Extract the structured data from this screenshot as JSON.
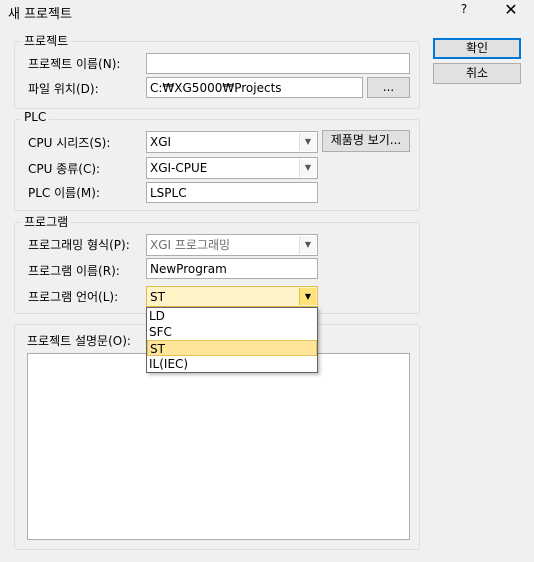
{
  "window": {
    "title": "새 프로젝트",
    "help_label": "?",
    "close_label": "✕"
  },
  "buttons": {
    "ok": "확인",
    "cancel": "취소",
    "browse": "...",
    "view_product": "제품명 보기..."
  },
  "project": {
    "legend": "프로젝트",
    "name_label": "프로젝트 이름(N):",
    "name_value": "",
    "path_label": "파일 위치(D):",
    "path_value": "C:₩XG5000₩Projects"
  },
  "plc": {
    "legend": "PLC",
    "series_label": "CPU 시리즈(S):",
    "series_value": "XGI",
    "type_label": "CPU 종류(C):",
    "type_value": "XGI-CPUE",
    "name_label": "PLC 이름(M):",
    "name_value": "LSPLC"
  },
  "program": {
    "legend": "프로그램",
    "form_label": "프로그래밍 형식(P):",
    "form_value": "XGI 프로그래밍",
    "name_label": "프로그램 이름(R):",
    "name_value": "NewProgram",
    "lang_label": "프로그램 언어(L):",
    "lang_value": "ST",
    "lang_options": [
      "LD",
      "SFC",
      "ST",
      "IL(IEC)"
    ],
    "lang_selected_index": 2
  },
  "description": {
    "legend": "프로젝트 설명문(O):",
    "value": ""
  }
}
